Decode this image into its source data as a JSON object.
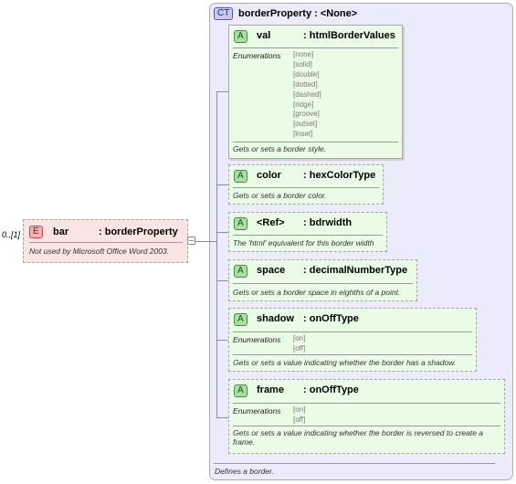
{
  "element": {
    "occurrence": "0..[1]",
    "badge": "E",
    "name": "bar",
    "type": ": borderProperty",
    "doc": "Not used by Microsoft Office Word 2003."
  },
  "complex_type": {
    "badge": "CT",
    "title": "borderProperty : <None>",
    "doc": "Defines a border."
  },
  "attributes": [
    {
      "badge": "A",
      "name": "val",
      "type": ": htmlBorderValues",
      "enum_label": "Enumerations",
      "enumerations": [
        "[none]",
        "[solid]",
        "[double]",
        "[dotted]",
        "[dashed]",
        "[ridge]",
        "[groove]",
        "[outset]",
        "[inset]"
      ],
      "doc": "Gets or sets a border style."
    },
    {
      "badge": "A",
      "name": "color",
      "type": ": hexColorType",
      "doc": "Gets or sets a border color."
    },
    {
      "badge": "A",
      "name": "<Ref>",
      "type": ": bdrwidth",
      "doc": "The 'html' equivalent for this border width"
    },
    {
      "badge": "A",
      "name": "space",
      "type": ": decimalNumberType",
      "doc": "Gets or sets a border space in eighths of a point."
    },
    {
      "badge": "A",
      "name": "shadow",
      "type": ": onOffType",
      "enum_label": "Enumerations",
      "enumerations": [
        "[on]",
        "[off]"
      ],
      "doc": "Gets or sets a value indicating whether the border has a shadow."
    },
    {
      "badge": "A",
      "name": "frame",
      "type": ": onOffType",
      "enum_label": "Enumerations",
      "enumerations": [
        "[on]",
        "[off]"
      ],
      "doc_line1": "Gets or sets a value indicating whether the border is reversed to create a",
      "doc_line2": "frame."
    }
  ]
}
